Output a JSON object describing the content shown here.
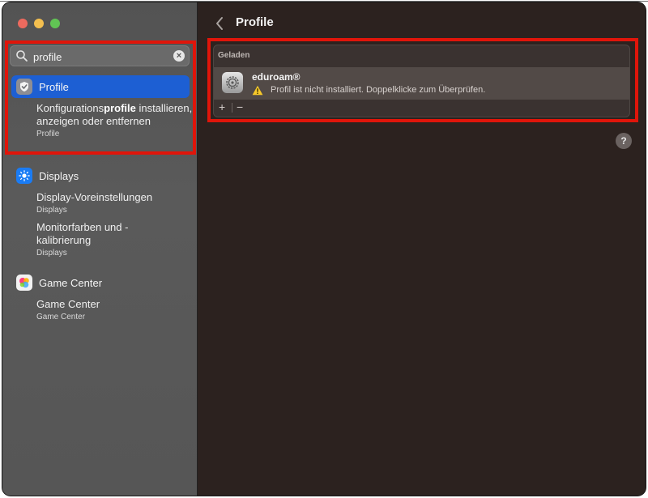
{
  "search": {
    "value": "profile",
    "clear_label": "×"
  },
  "sidebar": {
    "sections": [
      {
        "label": "Profile",
        "results": [
          {
            "title_pre": "Konfigurations",
            "title_bold": "profile",
            "title_post": " installieren, anzeigen oder entfernen",
            "sub": "Profile"
          }
        ]
      },
      {
        "label": "Displays",
        "results": [
          {
            "title": "Display-Voreinstellungen",
            "sub": "Displays"
          },
          {
            "title": "Monitorfarben und -kalibrierung",
            "sub": "Displays"
          }
        ]
      },
      {
        "label": "Game Center",
        "results": [
          {
            "title": "Game Center",
            "sub": "Game Center"
          }
        ]
      }
    ]
  },
  "main": {
    "title": "Profile",
    "group_label": "Geladen",
    "profile": {
      "name": "eduroam®",
      "warning": "Profil ist nicht installiert. Doppelklicke zum Überprüfen."
    },
    "add_label": "+",
    "remove_label": "−",
    "help_label": "?"
  },
  "colors": {
    "accent": "#1d5fd3",
    "highlight": "#e0150a",
    "sidebar": "#575757",
    "content": "#2c221f"
  }
}
